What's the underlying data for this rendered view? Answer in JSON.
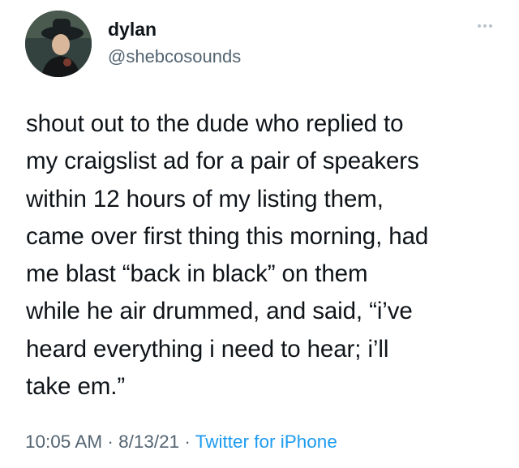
{
  "user": {
    "display_name": "dylan",
    "handle": "@shebcosounds",
    "avatar_icon": "profile-photo"
  },
  "more_icon": "more-options-icon",
  "tweet": {
    "text": "shout out to the dude who replied to\nmy craigslist ad for a pair of speakers\nwithin 12 hours of my listing them,\ncame over first thing this morning, had\nme blast “back in black” on them\nwhile he air drummed, and said, “i’ve\nheard everything i need to hear; i’ll\ntake em.”"
  },
  "meta": {
    "time": "10:05 AM",
    "separator": " · ",
    "date": "8/13/21",
    "source": "Twitter for iPhone"
  },
  "colors": {
    "text": "#0f1419",
    "secondary": "#536471",
    "link": "#1d9bf0"
  }
}
